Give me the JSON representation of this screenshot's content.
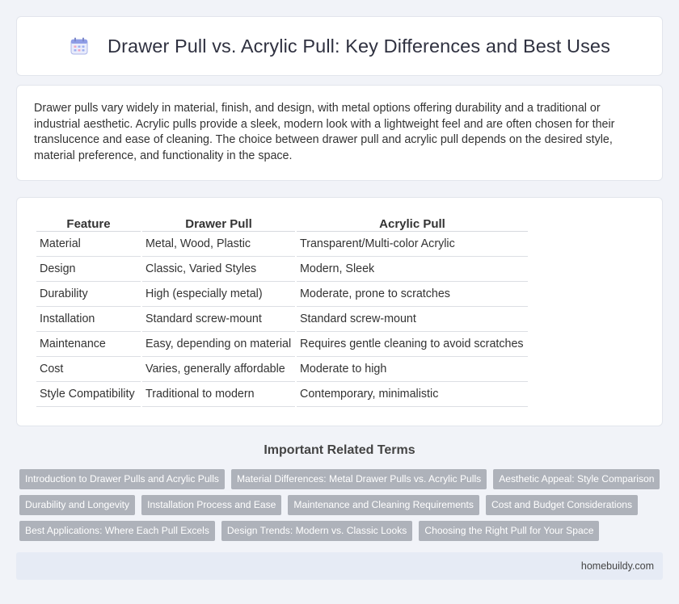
{
  "header": {
    "title": "Drawer Pull vs. Acrylic Pull: Key Differences and Best Uses",
    "icon": "calendar-icon"
  },
  "intro": {
    "text": "Drawer pulls vary widely in material, finish, and design, with metal options offering durability and a traditional or industrial aesthetic. Acrylic pulls provide a sleek, modern look with a lightweight feel and are often chosen for their translucence and ease of cleaning. The choice between drawer pull and acrylic pull depends on the desired style, material preference, and functionality in the space."
  },
  "table": {
    "headers": [
      "Feature",
      "Drawer Pull",
      "Acrylic Pull"
    ],
    "rows": [
      [
        "Material",
        "Metal, Wood, Plastic",
        "Transparent/Multi-color Acrylic"
      ],
      [
        "Design",
        "Classic, Varied Styles",
        "Modern, Sleek"
      ],
      [
        "Durability",
        "High (especially metal)",
        "Moderate, prone to scratches"
      ],
      [
        "Installation",
        "Standard screw-mount",
        "Standard screw-mount"
      ],
      [
        "Maintenance",
        "Easy, depending on material",
        "Requires gentle cleaning to avoid scratches"
      ],
      [
        "Cost",
        "Varies, generally affordable",
        "Moderate to high"
      ],
      [
        "Style Compatibility",
        "Traditional to modern",
        "Contemporary, minimalistic"
      ]
    ]
  },
  "terms": {
    "title": "Important Related Terms",
    "items": [
      "Introduction to Drawer Pulls and Acrylic Pulls",
      "Material Differences: Metal Drawer Pulls vs. Acrylic Pulls",
      "Aesthetic Appeal: Style Comparison",
      "Durability and Longevity",
      "Installation Process and Ease",
      "Maintenance and Cleaning Requirements",
      "Cost and Budget Considerations",
      "Best Applications: Where Each Pull Excels",
      "Design Trends: Modern vs. Classic Looks",
      "Choosing the Right Pull for Your Space"
    ]
  },
  "footer": {
    "text": "homebuildy.com"
  },
  "colors": {
    "background": "#f1f3f8",
    "tag": "#aeb2ba",
    "footer": "#e6ebf5",
    "icon_accent": "#6b7bd4"
  }
}
